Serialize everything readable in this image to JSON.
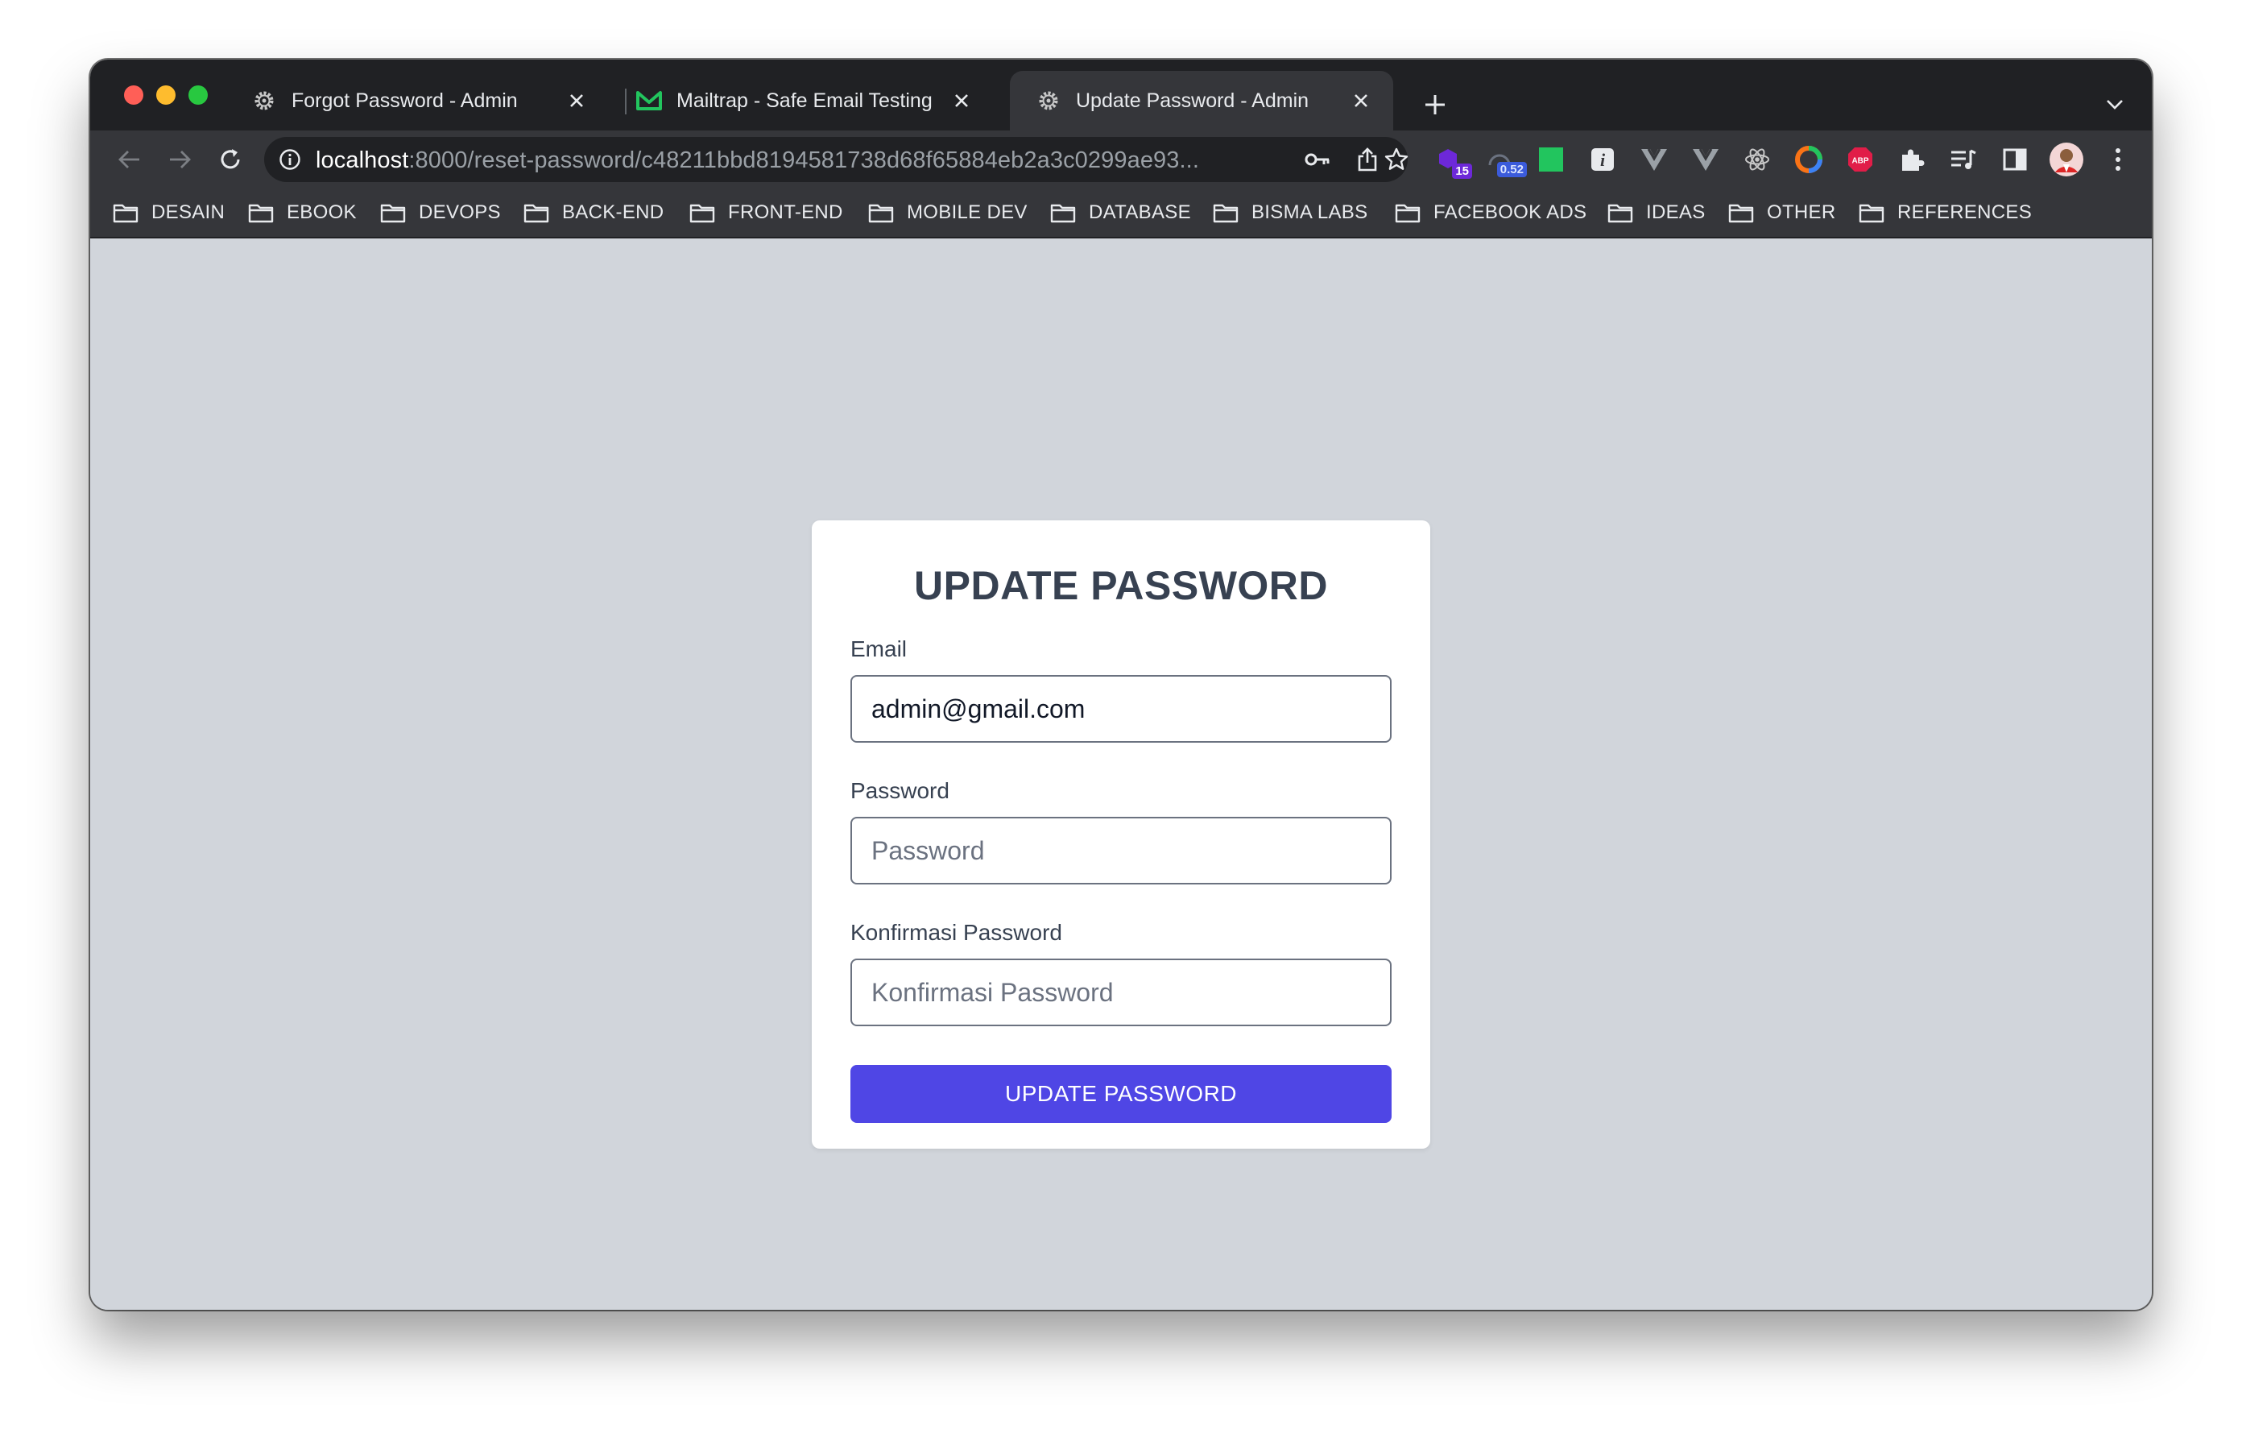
{
  "browser": {
    "tabs": [
      {
        "title": "Forgot Password - Admin",
        "favicon": "gear-icon",
        "active": false
      },
      {
        "title": "Mailtrap - Safe Email Testing",
        "favicon": "mailtrap-icon",
        "active": false
      },
      {
        "title": "Update Password - Admin",
        "favicon": "gear-icon",
        "active": true
      }
    ],
    "url_host": "localhost",
    "url_rest": ":8000/reset-password/c48211bbd8194581738d68f65884eb2a3c0299ae93...",
    "extensions": {
      "badge_count": "15",
      "badge_value": "0.52",
      "abp_label": "ABP"
    },
    "bookmarks": [
      "DESAIN",
      "EBOOK",
      "DEVOPS",
      "BACK-END",
      "FRONT-END",
      "MOBILE DEV",
      "DATABASE",
      "BISMA LABS",
      "FACEBOOK ADS",
      "IDEAS",
      "OTHER",
      "REFERENCES"
    ]
  },
  "form": {
    "title": "UPDATE PASSWORD",
    "email_label": "Email",
    "email_value": "admin@gmail.com",
    "password_label": "Password",
    "password_placeholder": "Password",
    "confirm_label": "Konfirmasi Password",
    "confirm_placeholder": "Konfirmasi Password",
    "submit_label": "UPDATE PASSWORD"
  },
  "colors": {
    "page_background": "#d1d5db",
    "card_background": "#ffffff",
    "button_primary": "#4f46e5",
    "heading_text": "#374151"
  }
}
